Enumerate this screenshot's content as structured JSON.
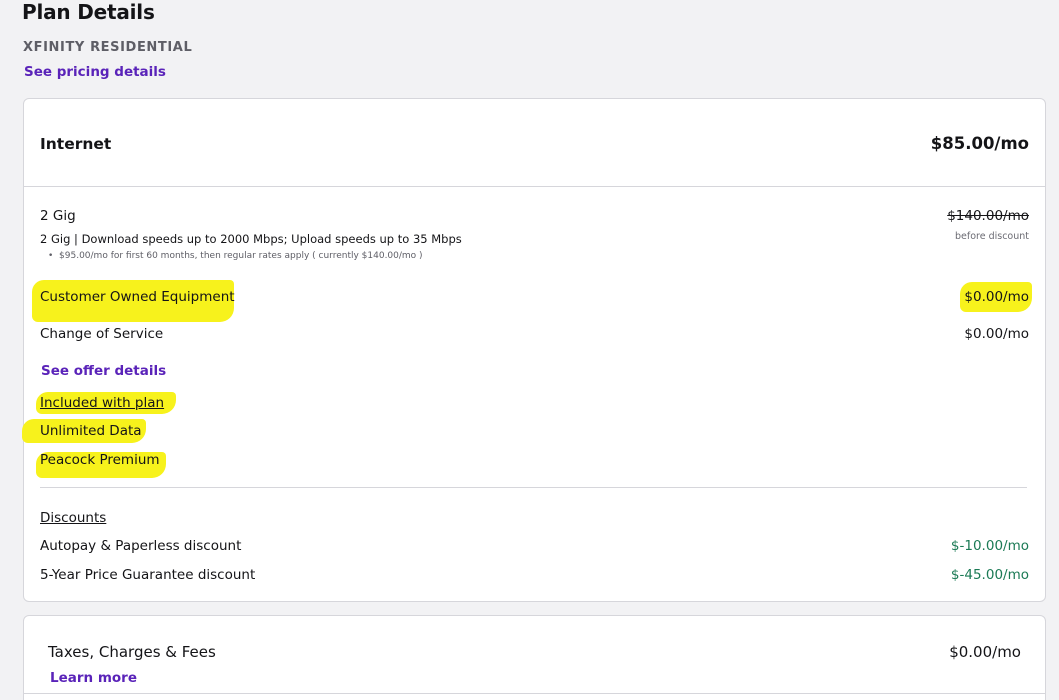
{
  "page": {
    "title": "Plan Details",
    "plan_name": "XFINITY RESIDENTIAL",
    "pricing_link": "See pricing details"
  },
  "internet": {
    "title": "Internet",
    "total_price": "$85.00/mo",
    "plan": {
      "name": "2 Gig",
      "original_price": "$140.00/mo",
      "price_note": "before discount",
      "description": "2 Gig | Download speeds up to 2000 Mbps; Upload speeds up to 35 Mbps",
      "bullet": "$95.00/mo for first 60 months, then regular rates apply ( currently $140.00/mo )"
    },
    "line_items": [
      {
        "label": "Customer Owned Equipment",
        "price": "$0.00/mo"
      },
      {
        "label": "Change of Service",
        "price": "$0.00/mo"
      }
    ],
    "offer_link": "See offer details",
    "included": {
      "heading": "Included with plan",
      "items": [
        "Unlimited Data",
        "Peacock Premium"
      ]
    },
    "discounts": {
      "heading": "Discounts",
      "items": [
        {
          "label": "Autopay & Paperless discount",
          "amount": "$-10.00/mo"
        },
        {
          "label": "5-Year Price Guarantee discount",
          "amount": "$-45.00/mo"
        }
      ]
    }
  },
  "taxes": {
    "title": "Taxes, Charges & Fees",
    "price": "$0.00/mo",
    "link": "Learn more"
  },
  "colors": {
    "accent": "#5a23b9",
    "discount": "#1b7a55",
    "highlight": "#f7f21c"
  }
}
